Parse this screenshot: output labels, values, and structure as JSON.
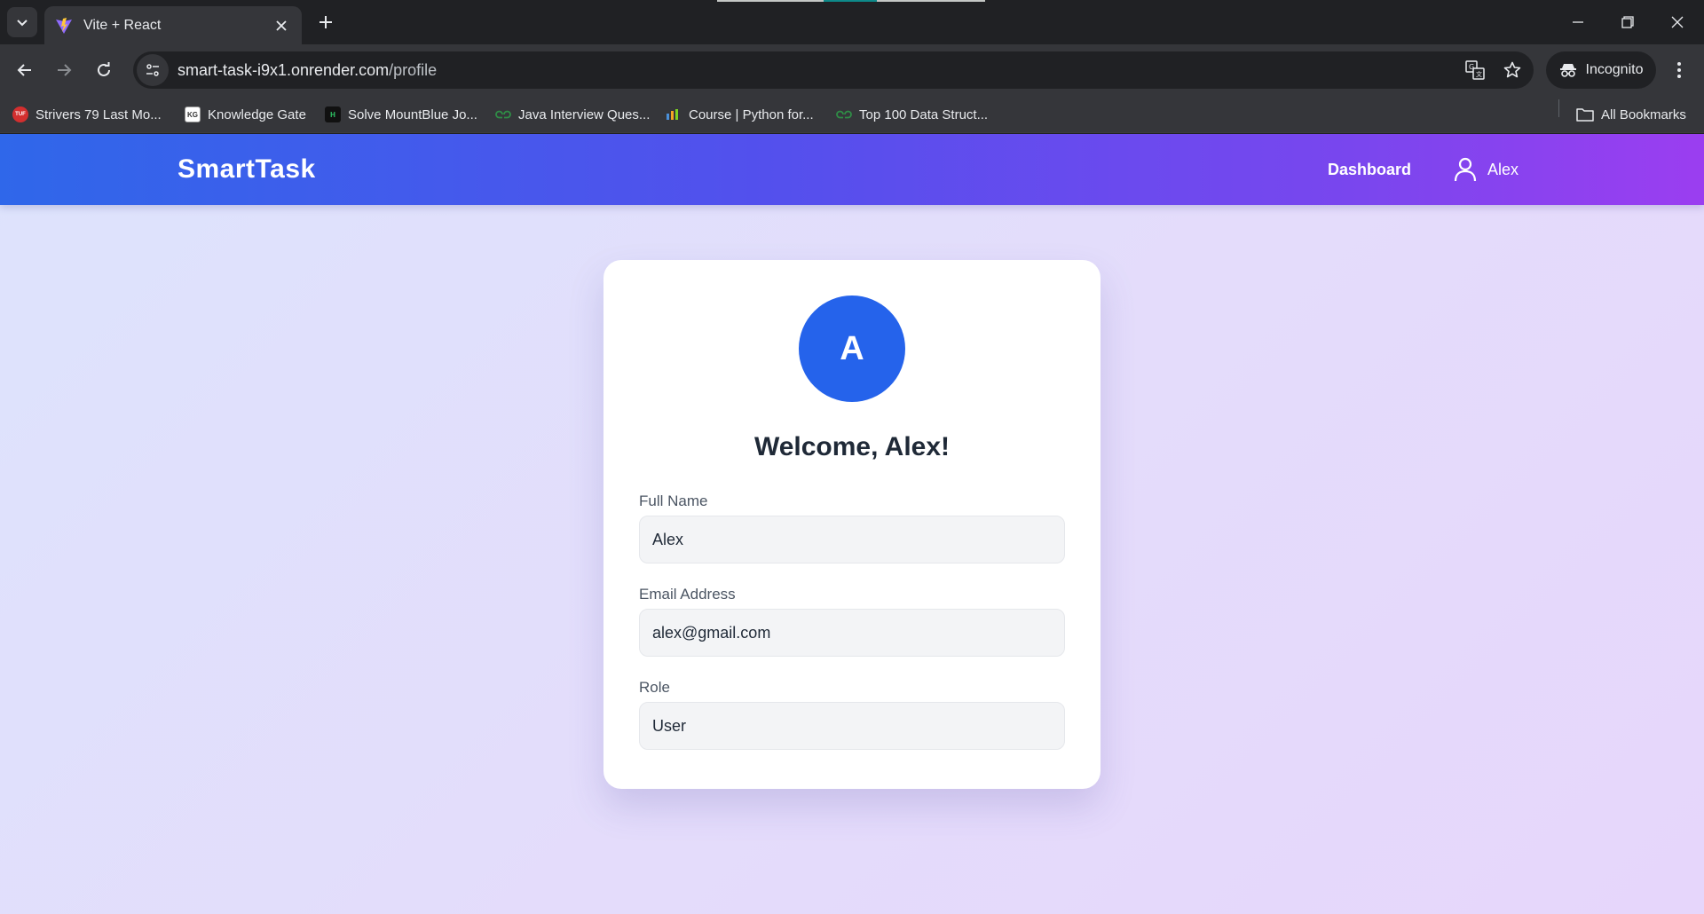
{
  "browser": {
    "tab_title": "Vite + React",
    "url_host": "smart-task-i9x1.onrender.com",
    "url_path": "/profile",
    "incognito_label": "Incognito",
    "bookmarks": [
      {
        "label": "Strivers 79 Last Mo...",
        "icon": "tuf-icon",
        "icon_text": "TUF"
      },
      {
        "label": "Knowledge Gate",
        "icon": "knowledge-gate-icon",
        "icon_text": "KG"
      },
      {
        "label": "Solve MountBlue Jo...",
        "icon": "hackerrank-icon",
        "icon_text": "H"
      },
      {
        "label": "Java Interview Ques...",
        "icon": "geeksforgeeks-icon",
        "icon_text": ""
      },
      {
        "label": "Course | Python for...",
        "icon": "course-icon",
        "icon_text": ""
      },
      {
        "label": "Top 100 Data Struct...",
        "icon": "geeksforgeeks-icon",
        "icon_text": ""
      }
    ],
    "all_bookmarks_label": "All Bookmarks"
  },
  "app": {
    "brand": "SmartTask",
    "nav": {
      "dashboard": "Dashboard",
      "user_name": "Alex"
    }
  },
  "profile": {
    "avatar_initial": "A",
    "welcome": "Welcome, Alex!",
    "fields": {
      "full_name": {
        "label": "Full Name",
        "value": "Alex"
      },
      "email": {
        "label": "Email Address",
        "value": "alex@gmail.com"
      },
      "role": {
        "label": "Role",
        "value": "User"
      }
    }
  },
  "colors": {
    "appbar_start": "#2f67ea",
    "appbar_end": "#9b3ef0",
    "avatar": "#2563eb",
    "page_bg": "#e2dffb"
  }
}
